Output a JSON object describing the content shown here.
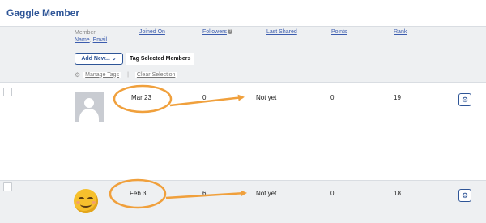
{
  "page": {
    "title": "Gaggle Member"
  },
  "columns": {
    "member_label": "Member:",
    "member_name": "Name",
    "member_sep": ", ",
    "member_email": "Email",
    "joined_on": "Joined On",
    "followers": "Followers",
    "last_shared": "Last Shared",
    "points": "Points",
    "rank": "Rank"
  },
  "toolbar": {
    "add_new_label": "Add New...",
    "tag_selected_label": "Tag Selected Members",
    "manage_tags_label": "Manage Tags",
    "separator": "|",
    "clear_selection_label": "Clear Selection"
  },
  "rows": [
    {
      "avatar": "default-avatar-icon",
      "joined_on": "Mar 23",
      "followers": "0",
      "last_shared": "Not yet",
      "points": "0",
      "rank": "19"
    },
    {
      "avatar": "smiley-emoji-avatar",
      "joined_on": "Feb 3",
      "followers": "6",
      "last_shared": "Not yet",
      "points": "0",
      "rank": "18"
    }
  ],
  "annotation_color": "#f0a03c",
  "accent_color": "#2e5597"
}
